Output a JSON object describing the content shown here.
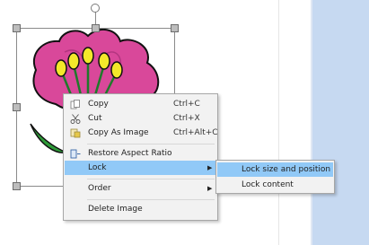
{
  "context_menu": {
    "items": [
      {
        "label": "Copy",
        "shortcut": "Ctrl+C",
        "icon": "copy-icon"
      },
      {
        "label": "Cut",
        "shortcut": "Ctrl+X",
        "icon": "cut-icon"
      },
      {
        "label": "Copy As Image",
        "shortcut": "Ctrl+Alt+C",
        "icon": "copy-as-image-icon"
      },
      {
        "label": "Restore Aspect Ratio",
        "shortcut": "",
        "icon": "restore-aspect-ratio-icon"
      },
      {
        "label": "Lock",
        "shortcut": "",
        "has_submenu": true,
        "highlighted": true
      },
      {
        "label": "Order",
        "shortcut": "",
        "has_submenu": true
      },
      {
        "label": "Delete Image",
        "shortcut": ""
      }
    ]
  },
  "lock_submenu": {
    "items": [
      {
        "label": "Lock size and position",
        "highlighted": true
      },
      {
        "label": "Lock content"
      }
    ]
  },
  "colors": {
    "menu_highlight": "#91c9f7",
    "menu_background": "#f2f2f2",
    "side_panel": "#c6d9f1",
    "petal": "#d9489a",
    "anther": "#f3e82a"
  }
}
